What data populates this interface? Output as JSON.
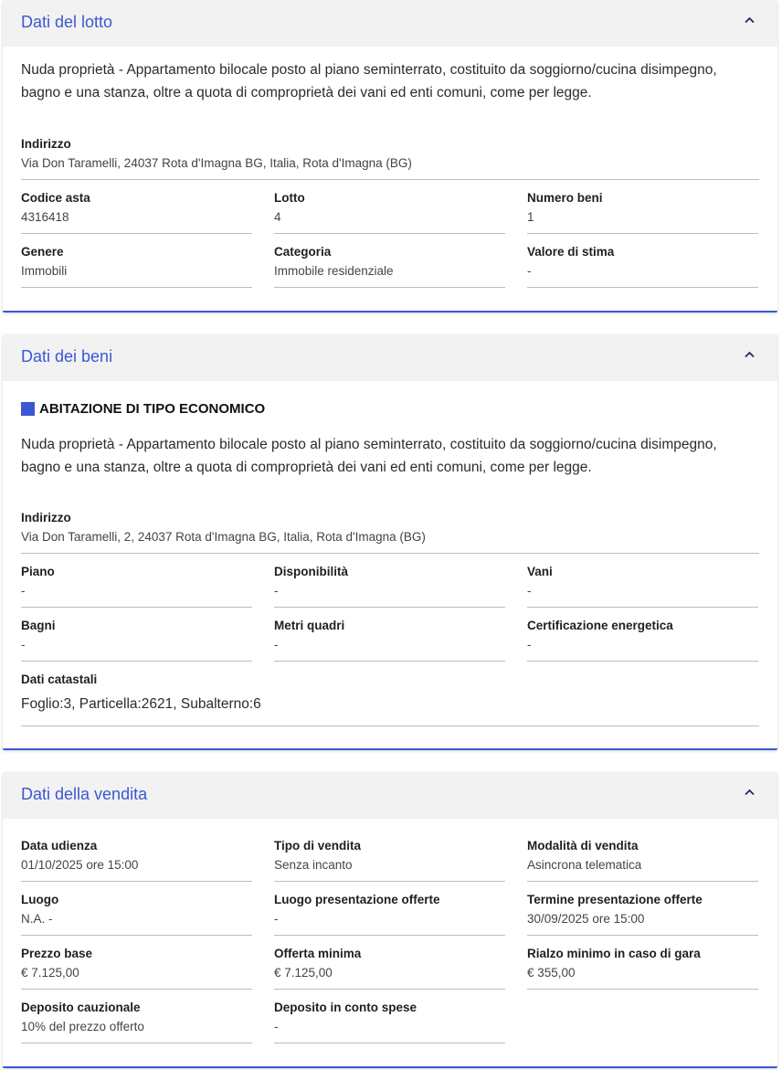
{
  "lotto": {
    "title": "Dati del lotto",
    "description": "Nuda proprietà - Appartamento bilocale posto al piano seminterrato, costituito da soggiorno/cucina disimpegno, bagno e una stanza, oltre a quota di comproprietà dei vani ed enti comuni, come per legge.",
    "indirizzo": {
      "label": "Indirizzo",
      "value": "Via Don Taramelli, 24037 Rota d'Imagna BG, Italia, Rota d'Imagna (BG)"
    },
    "fields": [
      {
        "label": "Codice asta",
        "value": "4316418"
      },
      {
        "label": "Lotto",
        "value": "4"
      },
      {
        "label": "Numero beni",
        "value": "1"
      },
      {
        "label": "Genere",
        "value": "Immobili"
      },
      {
        "label": "Categoria",
        "value": "Immobile residenziale"
      },
      {
        "label": "Valore di stima",
        "value": "-"
      }
    ]
  },
  "beni": {
    "title": "Dati dei beni",
    "subtitle": "ABITAZIONE DI TIPO ECONOMICO",
    "description": "Nuda proprietà - Appartamento bilocale posto al piano seminterrato, costituito da soggiorno/cucina disimpegno, bagno e una stanza, oltre a quota di comproprietà dei vani ed enti comuni, come per legge.",
    "indirizzo": {
      "label": "Indirizzo",
      "value": "Via Don Taramelli, 2, 24037 Rota d'Imagna BG, Italia, Rota d'Imagna (BG)"
    },
    "fields": [
      {
        "label": "Piano",
        "value": "-"
      },
      {
        "label": "Disponibilità",
        "value": "-"
      },
      {
        "label": "Vani",
        "value": "-"
      },
      {
        "label": "Bagni",
        "value": "-"
      },
      {
        "label": "Metri quadri",
        "value": "-"
      },
      {
        "label": "Certificazione energetica",
        "value": "-"
      }
    ],
    "catastali": {
      "label": "Dati catastali",
      "value": "Foglio:3, Particella:2621, Subalterno:6"
    }
  },
  "vendita": {
    "title": "Dati della vendita",
    "fields": [
      {
        "label": "Data udienza",
        "value": "01/10/2025 ore 15:00"
      },
      {
        "label": "Tipo di vendita",
        "value": "Senza incanto"
      },
      {
        "label": "Modalità di vendita",
        "value": "Asincrona telematica"
      },
      {
        "label": "Luogo",
        "value": "N.A. -"
      },
      {
        "label": "Luogo presentazione offerte",
        "value": "-"
      },
      {
        "label": "Termine presentazione offerte",
        "value": "30/09/2025 ore 15:00"
      },
      {
        "label": "Prezzo base",
        "value": "€ 7.125,00"
      },
      {
        "label": "Offerta minima",
        "value": "€ 7.125,00"
      },
      {
        "label": "Rialzo minimo in caso di gara",
        "value": "€ 355,00"
      },
      {
        "label": "Deposito cauzionale",
        "value": "10% del prezzo offerto"
      },
      {
        "label": "Deposito in conto spese",
        "value": "-"
      }
    ]
  },
  "colors": {
    "accent": "#3b57d4",
    "header_bg": "#f2f2f2"
  },
  "icons": {
    "collapse": "chevron-up-icon"
  }
}
